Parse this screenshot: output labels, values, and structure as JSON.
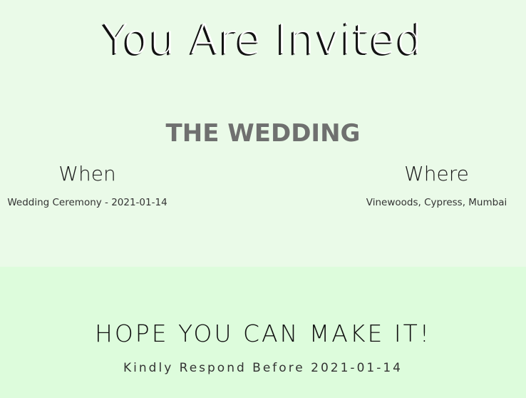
{
  "invite": {
    "title": "You Are Invited",
    "heading": "THE WEDDING",
    "when": {
      "label": "When",
      "detail": "Wedding Ceremony - 2021-01-14"
    },
    "where": {
      "label": "Where",
      "detail": "Vinewoods, Cypress, Mumbai"
    }
  },
  "rsvp": {
    "title": "HOPE YOU CAN MAKE IT!",
    "subtitle": "Kindly Respond Before 2021-01-14"
  },
  "colors": {
    "top_background": "#eafae8",
    "bottom_background": "#ddfcdc",
    "heading": "#6f706f"
  }
}
